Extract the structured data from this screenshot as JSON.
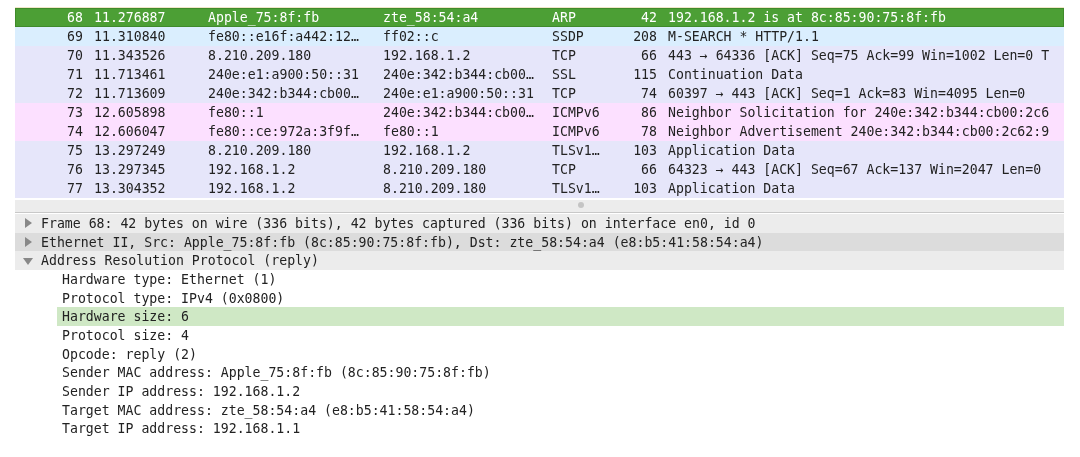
{
  "packet_list": {
    "rows": [
      {
        "no": "68",
        "time": "11.276887",
        "source": "Apple_75:8f:fb",
        "destination": "zte_58:54:a4",
        "protocol": "ARP",
        "length": "42",
        "info": "192.168.1.2 is at 8c:85:90:75:8f:fb",
        "color": "#4c9f35",
        "selected": true
      },
      {
        "no": "69",
        "time": "11.310840",
        "source": "fe80::e16f:a442:12…",
        "destination": "ff02::c",
        "protocol": "SSDP",
        "length": "208",
        "info": "M-SEARCH * HTTP/1.1",
        "color": "#daeefe",
        "selected": false
      },
      {
        "no": "70",
        "time": "11.343526",
        "source": "8.210.209.180",
        "destination": "192.168.1.2",
        "protocol": "TCP",
        "length": "66",
        "info": "443 → 64336 [ACK] Seq=75 Ack=99 Win=1002 Len=0 T",
        "color": "#e6e6fa",
        "selected": false
      },
      {
        "no": "71",
        "time": "11.713461",
        "source": "240e:e1:a900:50::31",
        "destination": "240e:342:b344:cb00…",
        "protocol": "SSL",
        "length": "115",
        "info": "Continuation Data",
        "color": "#e6e6fa",
        "selected": false
      },
      {
        "no": "72",
        "time": "11.713609",
        "source": "240e:342:b344:cb00…",
        "destination": "240e:e1:a900:50::31",
        "protocol": "TCP",
        "length": "74",
        "info": "60397 → 443 [ACK] Seq=1 Ack=83 Win=4095 Len=0",
        "color": "#e6e6fa",
        "selected": false
      },
      {
        "no": "73",
        "time": "12.605898",
        "source": "fe80::1",
        "destination": "240e:342:b344:cb00…",
        "protocol": "ICMPv6",
        "length": "86",
        "info": "Neighbor Solicitation for 240e:342:b344:cb00:2c6",
        "color": "#fce0ff",
        "selected": false
      },
      {
        "no": "74",
        "time": "12.606047",
        "source": "fe80::ce:972a:3f9f…",
        "destination": "fe80::1",
        "protocol": "ICMPv6",
        "length": "78",
        "info": "Neighbor Advertisement 240e:342:b344:cb00:2c62:9",
        "color": "#fce0ff",
        "selected": false
      },
      {
        "no": "75",
        "time": "13.297249",
        "source": "8.210.209.180",
        "destination": "192.168.1.2",
        "protocol": "TLSv1…",
        "length": "103",
        "info": "Application Data",
        "color": "#e6e6fa",
        "selected": false
      },
      {
        "no": "76",
        "time": "13.297345",
        "source": "192.168.1.2",
        "destination": "8.210.209.180",
        "protocol": "TCP",
        "length": "66",
        "info": "64323 → 443 [ACK] Seq=67 Ack=137 Win=2047 Len=0",
        "color": "#e6e6fa",
        "selected": false
      },
      {
        "no": "77",
        "time": "13.304352",
        "source": "192.168.1.2",
        "destination": "8.210.209.180",
        "protocol": "TLSv1…",
        "length": "103",
        "info": "Application Data",
        "color": "#e6e6fa",
        "selected": false
      }
    ]
  },
  "packet_details": [
    {
      "label": "Frame 68: 42 bytes on wire (336 bits), 42 bytes captured (336 bits) on interface en0, id 0",
      "expanded": false,
      "selected": false
    },
    {
      "label": "Ethernet II, Src: Apple_75:8f:fb (8c:85:90:75:8f:fb), Dst: zte_58:54:a4 (e8:b5:41:58:54:a4)",
      "expanded": false,
      "selected": true
    },
    {
      "label": "Address Resolution Protocol (reply)",
      "expanded": true,
      "selected": false,
      "children": [
        {
          "label": "Hardware type: Ethernet (1)",
          "selected": false
        },
        {
          "label": "Protocol type: IPv4 (0x0800)",
          "selected": false
        },
        {
          "label": "Hardware size: 6",
          "selected": true
        },
        {
          "label": "Protocol size: 4",
          "selected": false
        },
        {
          "label": "Opcode: reply (2)",
          "selected": false
        },
        {
          "label": "Sender MAC address: Apple_75:8f:fb (8c:85:90:75:8f:fb)",
          "selected": false
        },
        {
          "label": "Sender IP address: 192.168.1.2",
          "selected": false
        },
        {
          "label": "Target MAC address: zte_58:54:a4 (e8:b5:41:58:54:a4)",
          "selected": false
        },
        {
          "label": "Target IP address: 192.168.1.1",
          "selected": false
        }
      ]
    }
  ]
}
